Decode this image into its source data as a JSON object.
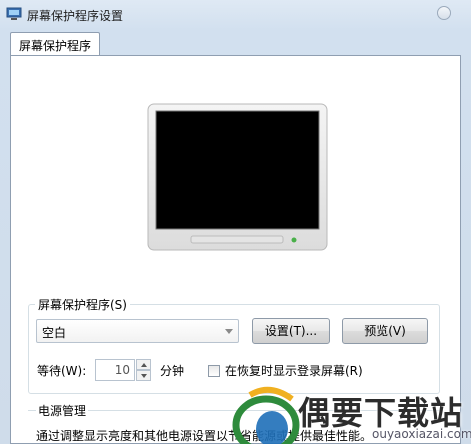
{
  "window": {
    "title": "屏幕保护程序设置"
  },
  "tabs": [
    {
      "label": "屏幕保护程序"
    }
  ],
  "screensaver": {
    "group_label": "屏幕保护程序(S)",
    "selected": "空白",
    "settings_button": "设置(T)...",
    "preview_button": "预览(V)",
    "wait_label": "等待(W):",
    "wait_value": "10",
    "wait_unit": "分钟",
    "logon_checkbox_label": "在恢复时显示登录屏幕(R)",
    "logon_checked": false
  },
  "power": {
    "group_label": "电源管理",
    "description": "通过调整显示亮度和其他电源设置以节省能源或提供最佳性能。"
  },
  "watermark": {
    "brand": "偶要下载站",
    "url": "ouyaoxiazai.com"
  },
  "colors": {
    "window_bg": "#d2e0ef",
    "panel_bg": "#ffffff",
    "border": "#8f9eb1"
  }
}
